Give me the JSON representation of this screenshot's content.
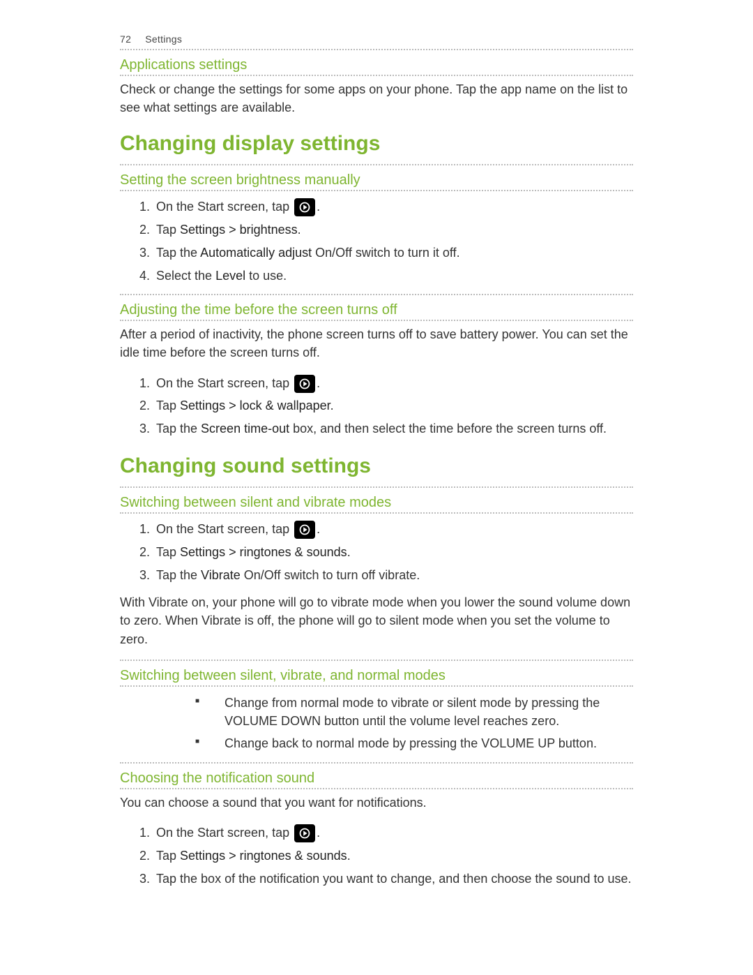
{
  "header": {
    "page_number": "72",
    "section": "Settings"
  },
  "applications": {
    "heading": "Applications settings",
    "body": "Check or change the settings for some apps on your phone. Tap the app name on the list to see what settings are available."
  },
  "display": {
    "title": "Changing display settings",
    "brightness": {
      "heading": "Setting the screen brightness manually",
      "steps": [
        {
          "pre": "On the Start screen, tap ",
          "icon": true,
          "post": "."
        },
        {
          "pre": "Tap ",
          "em": "Settings > brightness",
          "post": "."
        },
        {
          "pre": "Tap the ",
          "em": "Automatically adjust",
          "post": " On/Off switch to turn it off."
        },
        {
          "pre": "Select the ",
          "em": "Level",
          "post": " to use."
        }
      ]
    },
    "timeout": {
      "heading": "Adjusting the time before the screen turns off",
      "intro": "After a period of inactivity, the phone screen turns off to save battery power. You can set the idle time before the screen turns off.",
      "steps": [
        {
          "pre": "On the Start screen, tap ",
          "icon": true,
          "post": "."
        },
        {
          "pre": "Tap ",
          "em": "Settings > lock & wallpaper",
          "post": "."
        },
        {
          "pre": "Tap the ",
          "em": "Screen time-out",
          "post": " box, and then select the time before the screen turns off."
        }
      ]
    }
  },
  "sound": {
    "title": "Changing sound settings",
    "silent_vibrate": {
      "heading": "Switching between silent and vibrate modes",
      "steps": [
        {
          "pre": "On the Start screen, tap ",
          "icon": true,
          "post": "."
        },
        {
          "pre": "Tap ",
          "em": "Settings > ringtones & sounds",
          "post": "."
        },
        {
          "pre": "Tap the ",
          "em": "Vibrate",
          "post": " On/Off switch to turn off vibrate."
        }
      ],
      "note": "With Vibrate on, your phone will go to vibrate mode when you lower the sound volume down to zero. When Vibrate is off, the phone will go to silent mode when you set the volume to zero."
    },
    "modes": {
      "heading": "Switching between silent, vibrate, and normal modes",
      "bullets": [
        "Change from normal mode to vibrate or silent mode by pressing the VOLUME DOWN button until the volume level reaches zero.",
        "Change back to normal mode by pressing the VOLUME UP button."
      ]
    },
    "notification": {
      "heading": "Choosing the notification sound",
      "intro": "You can choose a sound that you want for notifications.",
      "steps": [
        {
          "pre": "On the Start screen, tap ",
          "icon": true,
          "post": "."
        },
        {
          "pre": "Tap ",
          "em": "Settings > ringtones & sounds",
          "post": "."
        },
        {
          "pre": "Tap the box of the notification you want to change, and then choose the sound to use.",
          "em": "",
          "post": ""
        }
      ]
    }
  }
}
